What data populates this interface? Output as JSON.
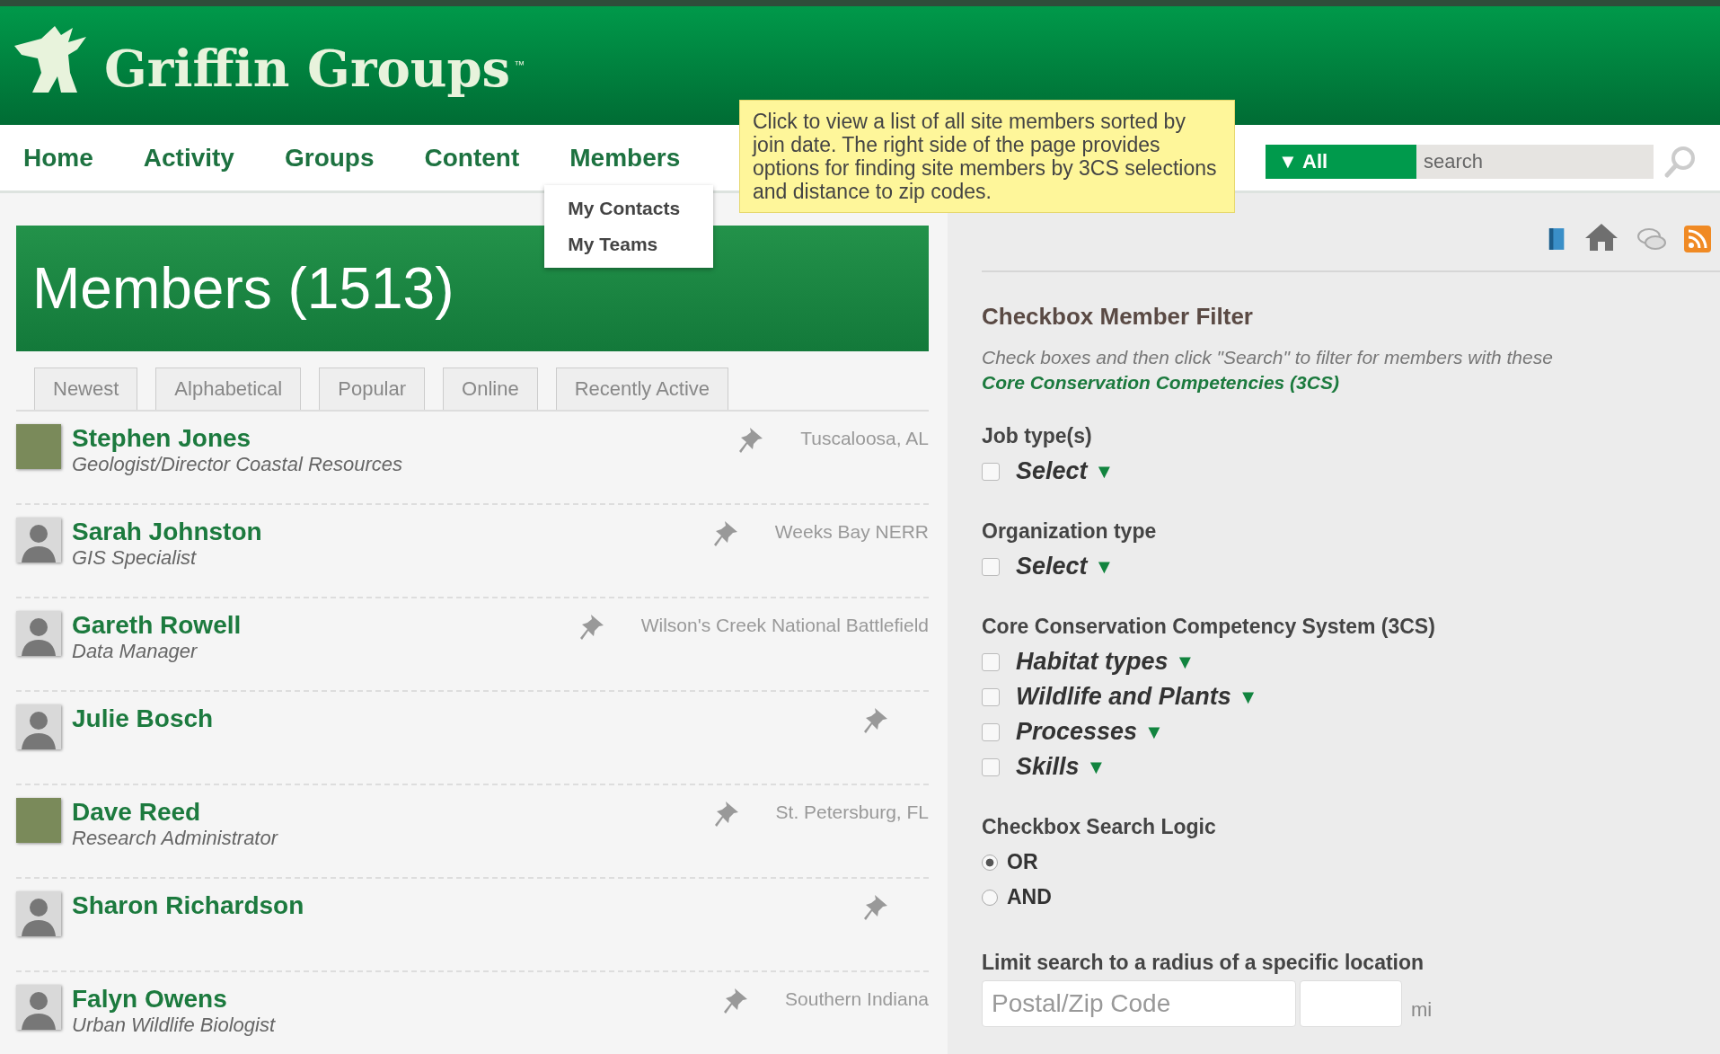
{
  "header": {
    "logo_text": "Griffin Groups",
    "trademark": "™"
  },
  "nav": {
    "items": [
      {
        "label": "Home"
      },
      {
        "label": "Activity"
      },
      {
        "label": "Groups"
      },
      {
        "label": "Content"
      },
      {
        "label": "Members",
        "submenu": [
          "My Contacts",
          "My Teams"
        ]
      }
    ],
    "tooltip": "Click to view a list of all site members sorted by join date. The right side of the page provides options for finding site members by 3CS selections and distance to zip codes.",
    "scope_button": "▼ All",
    "search": {
      "placeholder": "search"
    }
  },
  "page": {
    "title": "Members (1513)"
  },
  "tabs": [
    {
      "label": "Newest",
      "selected": false
    },
    {
      "label": "Alphabetical",
      "selected": false
    },
    {
      "label": "Popular",
      "selected": false
    },
    {
      "label": "Online",
      "selected": false
    },
    {
      "label": "Recently Active",
      "selected": false
    }
  ],
  "members": [
    {
      "name": "Stephen Jones",
      "title": "Geologist/Director Coastal Resources",
      "location": "Tuscaloosa, AL",
      "kind": "photo"
    },
    {
      "name": "Sarah Johnston",
      "title": "GIS Specialist",
      "location": "Weeks Bay NERR",
      "kind": "silhouette"
    },
    {
      "name": "Gareth Rowell",
      "title": "Data Manager",
      "location": "Wilson's Creek National Battlefield",
      "kind": "silhouette"
    },
    {
      "name": "Julie Bosch",
      "kind": "silhouette"
    },
    {
      "name": "Dave Reed",
      "title": "Research Administrator",
      "location": "St. Petersburg, FL",
      "kind": "photo"
    },
    {
      "name": "Sharon Richardson",
      "kind": "silhouette"
    },
    {
      "name": "Falyn Owens",
      "title": "Urban Wildlife Biologist",
      "location": "Southern Indiana",
      "kind": "silhouette"
    }
  ],
  "filter": {
    "heading": "Checkbox Member Filter",
    "intro": "Check boxes and then click \"Search\" to filter for members with these",
    "intro_link": "Core Conservation Competencies (3CS)",
    "groups": [
      {
        "label": "Job type(s)",
        "options": [
          {
            "label": "Select",
            "arrow": "▼",
            "checked": false
          }
        ]
      },
      {
        "label": "Organization type",
        "options": [
          {
            "label": "Select",
            "arrow": "▼",
            "checked": false
          }
        ]
      },
      {
        "label": "Core Conservation Competency System (3CS)",
        "options": [
          {
            "label": "Habitat types",
            "arrow": "▼",
            "checked": false
          },
          {
            "label": "Wildlife and Plants",
            "arrow": "▼",
            "checked": false
          },
          {
            "label": "Processes",
            "arrow": "▼",
            "checked": false
          },
          {
            "label": "Skills",
            "arrow": "▼",
            "checked": false
          }
        ]
      }
    ],
    "logic": {
      "label": "Checkbox Search Logic",
      "options": [
        {
          "label": "OR",
          "selected": true
        },
        {
          "label": "AND",
          "selected": false
        }
      ]
    },
    "radius": {
      "label": "Limit search to a radius of a specific location",
      "placeholder": "Postal/Zip Code",
      "unit": "mi"
    }
  }
}
